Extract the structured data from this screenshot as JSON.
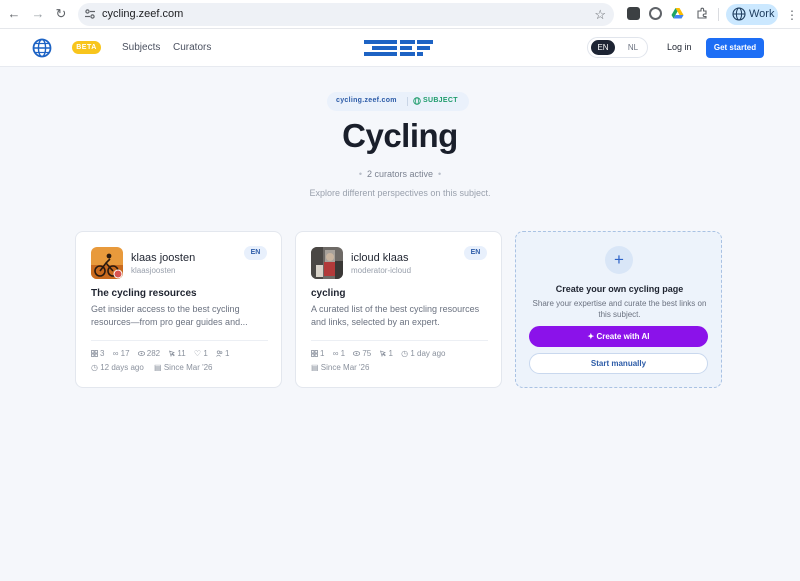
{
  "browser": {
    "url": "cycling.zeef.com",
    "profile_label": "Work",
    "extensions": [
      "q-extension-icon",
      "vpn-extension-icon",
      "drive-icon",
      "puzzle-icon"
    ]
  },
  "header": {
    "beta": "BETA",
    "nav": [
      "Subjects",
      "Curators"
    ],
    "languages": [
      "EN",
      "NL"
    ],
    "active_language": "EN",
    "login": "Log in",
    "get_started": "Get started",
    "brand_color": "#1d6ef5"
  },
  "hero": {
    "pill_domain": "cycling.zeef.com",
    "pill_subject": "SUBJECT",
    "title": "Cycling",
    "curators_active": "2 curators active",
    "subtitle": "Explore different perspectives on this subject."
  },
  "cards": [
    {
      "curator_name": "klaas joosten",
      "curator_handle": "klaasjoosten",
      "language": "EN",
      "title": "The cycling resources",
      "description": "Get insider access to the best cycling resources—from pro gear guides and...",
      "stats": [
        "3",
        "17",
        "282",
        "11",
        "1",
        "1"
      ],
      "updated": "12 days ago",
      "since": "Since Mar '26"
    },
    {
      "curator_name": "icloud klaas",
      "curator_handle": "moderator-icloud",
      "language": "EN",
      "title": "cycling",
      "description": "A curated list of the best cycling resources and links, selected by an expert.",
      "stats": [
        "1",
        "1",
        "75",
        "1"
      ],
      "updated": "1 day ago",
      "since": "Since Mar '26"
    }
  ],
  "create": {
    "title": "Create your own cycling page",
    "description": "Share your expertise and curate the best links on this subject.",
    "ai_button": "Create with AI",
    "manual_button": "Start manually",
    "ai_color": "#8b12ea"
  }
}
